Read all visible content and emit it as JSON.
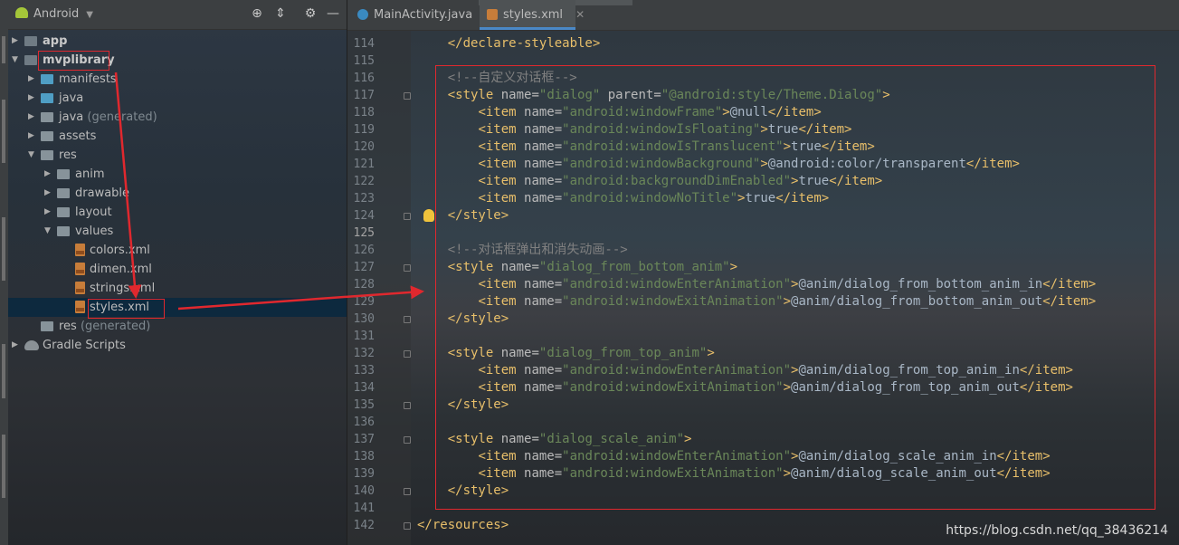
{
  "project_panel": {
    "view_selector": "Android",
    "tree": [
      {
        "label": "app",
        "bold": true,
        "icon": "module-folder-icon",
        "expanded": false
      },
      {
        "label": "mvplibrary",
        "bold": true,
        "icon": "module-folder-icon",
        "expanded": true
      },
      {
        "label": "manifests",
        "icon": "folder-icon",
        "expanded": false
      },
      {
        "label": "java",
        "icon": "folder-icon",
        "expanded": false
      },
      {
        "label": "java",
        "suffix": "(generated)",
        "icon": "folder-icon",
        "expanded": false
      },
      {
        "label": "assets",
        "icon": "folder-icon",
        "expanded": false
      },
      {
        "label": "res",
        "icon": "folder-icon",
        "expanded": true
      },
      {
        "label": "anim",
        "icon": "folder-icon",
        "expanded": false
      },
      {
        "label": "drawable",
        "icon": "folder-icon",
        "expanded": false
      },
      {
        "label": "layout",
        "icon": "folder-icon",
        "expanded": false
      },
      {
        "label": "values",
        "icon": "folder-icon",
        "expanded": true
      },
      {
        "label": "colors.xml",
        "icon": "xml-file-icon"
      },
      {
        "label": "dimen.xml",
        "icon": "xml-file-icon"
      },
      {
        "label": "strings.xml",
        "icon": "xml-file-icon"
      },
      {
        "label": "styles.xml",
        "icon": "xml-file-icon",
        "selected": true
      },
      {
        "label": "res",
        "suffix": "(generated)",
        "icon": "folder-icon"
      },
      {
        "label": "Gradle Scripts",
        "icon": "gradle-icon",
        "expanded": false
      }
    ]
  },
  "tabs": [
    {
      "label": "MainActivity.java",
      "icon": "java-class-icon",
      "active": false
    },
    {
      "label": "styles.xml",
      "icon": "xml-file-icon",
      "active": true
    }
  ],
  "editor": {
    "current_line": 125,
    "lines": [
      {
        "n": 114,
        "html": "    <span class='t-tag'>&lt;/declare-styleable&gt;</span>"
      },
      {
        "n": 115,
        "html": ""
      },
      {
        "n": 116,
        "html": "    <span class='t-cmt'>&lt;!--自定义对话框--&gt;</span>"
      },
      {
        "n": 117,
        "html": "    <span class='t-tag'>&lt;style </span><span class='t-attr'>name=</span><span class='t-val'>\"dialog\"</span><span class='t-attr'> parent=</span><span class='t-val'>\"@android:style/Theme.Dialog\"</span><span class='t-tag'>&gt;</span>"
      },
      {
        "n": 118,
        "html": "        <span class='t-tag'>&lt;item </span><span class='t-attr'>name=</span><span class='t-val'>\"android:windowFrame\"</span><span class='t-tag'>&gt;</span><span class='t-txt'>@null</span><span class='t-tag'>&lt;/item&gt;</span>"
      },
      {
        "n": 119,
        "html": "        <span class='t-tag'>&lt;item </span><span class='t-attr'>name=</span><span class='t-val'>\"android:windowIsFloating\"</span><span class='t-tag'>&gt;</span><span class='t-txt'>true</span><span class='t-tag'>&lt;/item&gt;</span>"
      },
      {
        "n": 120,
        "html": "        <span class='t-tag'>&lt;item </span><span class='t-attr'>name=</span><span class='t-val'>\"android:windowIsTranslucent\"</span><span class='t-tag'>&gt;</span><span class='t-txt'>true</span><span class='t-tag'>&lt;/item&gt;</span>"
      },
      {
        "n": 121,
        "html": "        <span class='t-tag'>&lt;item </span><span class='t-attr'>name=</span><span class='t-val'>\"android:windowBackground\"</span><span class='t-tag'>&gt;</span><span class='t-txt'>@android:color/transparent</span><span class='t-tag'>&lt;/item&gt;</span>"
      },
      {
        "n": 122,
        "html": "        <span class='t-tag'>&lt;item </span><span class='t-attr'>name=</span><span class='t-val'>\"android:backgroundDimEnabled\"</span><span class='t-tag'>&gt;</span><span class='t-txt'>true</span><span class='t-tag'>&lt;/item&gt;</span>"
      },
      {
        "n": 123,
        "html": "        <span class='t-tag'>&lt;item </span><span class='t-attr'>name=</span><span class='t-val'>\"android:windowNoTitle\"</span><span class='t-tag'>&gt;</span><span class='t-txt'>true</span><span class='t-tag'>&lt;/item&gt;</span>"
      },
      {
        "n": 124,
        "html": "    <span class='t-tag'>&lt;/style&gt;</span>"
      },
      {
        "n": 125,
        "html": ""
      },
      {
        "n": 126,
        "html": "    <span class='t-cmt'>&lt;!--对话框弹出和消失动画--&gt;</span>"
      },
      {
        "n": 127,
        "html": "    <span class='t-tag'>&lt;style </span><span class='t-attr'>name=</span><span class='t-val'>\"dialog_from_bottom_anim\"</span><span class='t-tag'>&gt;</span>"
      },
      {
        "n": 128,
        "html": "        <span class='t-tag'>&lt;item </span><span class='t-attr'>name=</span><span class='t-val'>\"android:windowEnterAnimation\"</span><span class='t-tag'>&gt;</span><span class='t-txt'>@anim/dialog_from_bottom_anim_in</span><span class='t-tag'>&lt;/item&gt;</span>"
      },
      {
        "n": 129,
        "html": "        <span class='t-tag'>&lt;item </span><span class='t-attr'>name=</span><span class='t-val'>\"android:windowExitAnimation\"</span><span class='t-tag'>&gt;</span><span class='t-txt'>@anim/dialog_from_bottom_anim_out</span><span class='t-tag'>&lt;/item&gt;</span>"
      },
      {
        "n": 130,
        "html": "    <span class='t-tag'>&lt;/style&gt;</span>"
      },
      {
        "n": 131,
        "html": ""
      },
      {
        "n": 132,
        "html": "    <span class='t-tag'>&lt;style </span><span class='t-attr'>name=</span><span class='t-val'>\"dialog_from_top_anim\"</span><span class='t-tag'>&gt;</span>"
      },
      {
        "n": 133,
        "html": "        <span class='t-tag'>&lt;item </span><span class='t-attr'>name=</span><span class='t-val'>\"android:windowEnterAnimation\"</span><span class='t-tag'>&gt;</span><span class='t-txt'>@anim/dialog_from_top_anim_in</span><span class='t-tag'>&lt;/item&gt;</span>"
      },
      {
        "n": 134,
        "html": "        <span class='t-tag'>&lt;item </span><span class='t-attr'>name=</span><span class='t-val'>\"android:windowExitAnimation\"</span><span class='t-tag'>&gt;</span><span class='t-txt'>@anim/dialog_from_top_anim_out</span><span class='t-tag'>&lt;/item&gt;</span>"
      },
      {
        "n": 135,
        "html": "    <span class='t-tag'>&lt;/style&gt;</span>"
      },
      {
        "n": 136,
        "html": ""
      },
      {
        "n": 137,
        "html": "    <span class='t-tag'>&lt;style </span><span class='t-attr'>name=</span><span class='t-val'>\"dialog_scale_anim\"</span><span class='t-tag'>&gt;</span>"
      },
      {
        "n": 138,
        "html": "        <span class='t-tag'>&lt;item </span><span class='t-attr'>name=</span><span class='t-val'>\"android:windowEnterAnimation\"</span><span class='t-tag'>&gt;</span><span class='t-txt'>@anim/dialog_scale_anim_in</span><span class='t-tag'>&lt;/item&gt;</span>"
      },
      {
        "n": 139,
        "html": "        <span class='t-tag'>&lt;item </span><span class='t-attr'>name=</span><span class='t-val'>\"android:windowExitAnimation\"</span><span class='t-tag'>&gt;</span><span class='t-txt'>@anim/dialog_scale_anim_out</span><span class='t-tag'>&lt;/item&gt;</span>"
      },
      {
        "n": 140,
        "html": "    <span class='t-tag'>&lt;/style&gt;</span>"
      },
      {
        "n": 141,
        "html": ""
      },
      {
        "n": 142,
        "html": "<span class='t-tag'>&lt;/resources&gt;</span>"
      }
    ]
  },
  "watermark": "https://blog.csdn.net/qq_38436214",
  "colors": {
    "annotation_red": "#e0282e",
    "xml_tag": "#e8bf6a",
    "xml_value": "#6a8759",
    "comment": "#808080",
    "selection": "#0d293e"
  }
}
